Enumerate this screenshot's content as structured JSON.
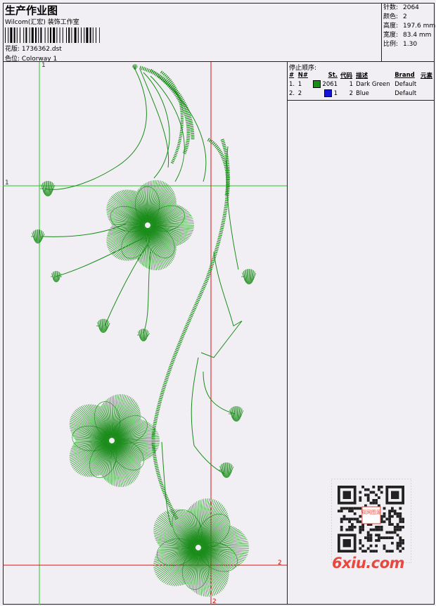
{
  "header": {
    "title": "生产作业图",
    "subtitle": "Wilcom(汇宏) 装饰工作室",
    "design_label": "花版:",
    "design_value": "1736362.dst",
    "colorway_label": "色位:",
    "colorway_value": "Colorway 1"
  },
  "stats": [
    {
      "label": "针数:",
      "value": "2064"
    },
    {
      "label": "颜色:",
      "value": "2"
    },
    {
      "label": "高度:",
      "value": "197.6 mm"
    },
    {
      "label": "宽度:",
      "value": "83.4 mm"
    },
    {
      "label": "比例:",
      "value": "1.30"
    }
  ],
  "stop_sequence": {
    "title": "停止顺序:",
    "columns": [
      "#",
      "N#",
      "St.",
      "代码",
      "描述",
      "Brand",
      "元素"
    ],
    "rows": [
      {
        "idx": "1.",
        "n": "1",
        "color": "#1a8c1a",
        "stitches": "2061",
        "code": "1",
        "desc": "Dark Green",
        "brand": "Default"
      },
      {
        "idx": "2.",
        "n": "2",
        "color": "#1414d6",
        "stitches": "1",
        "code": "2",
        "desc": "Blue",
        "brand": "Default"
      }
    ]
  },
  "guides": {
    "v1": "1",
    "h1": "1",
    "v2": "2",
    "h2": "2"
  },
  "watermark": {
    "brand": "6xiu.com",
    "qr_caption": "双网图源"
  },
  "colors": {
    "thread": "#1a8c1a",
    "guide_green": "#22cc22",
    "guide_red": "#dd1111",
    "watermark": "#e8483e"
  }
}
